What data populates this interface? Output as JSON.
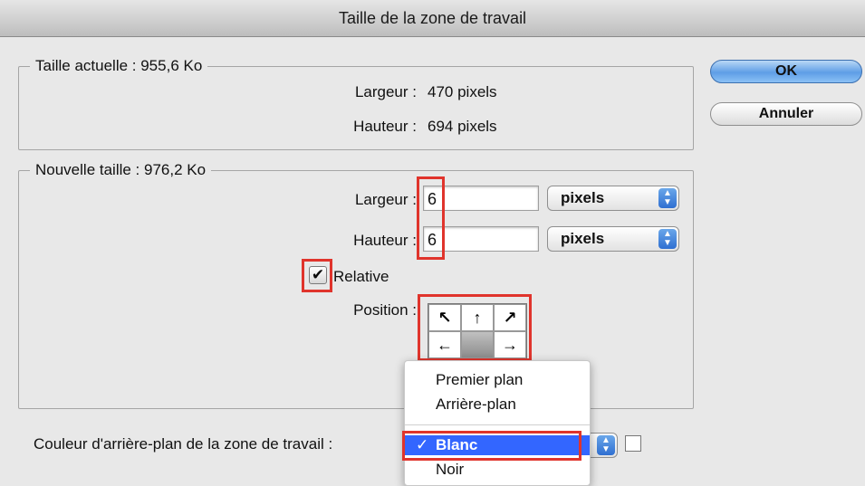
{
  "window": {
    "title": "Taille de la zone de travail"
  },
  "current_size": {
    "legend": "Taille actuelle : 955,6 Ko",
    "width_label": "Largeur :",
    "width_value": "470 pixels",
    "height_label": "Hauteur :",
    "height_value": "694 pixels"
  },
  "new_size": {
    "legend": "Nouvelle taille : 976,2 Ko",
    "width_label": "Largeur :",
    "width_value": "6",
    "width_unit": "pixels",
    "height_label": "Hauteur :",
    "height_value": "6",
    "height_unit": "pixels",
    "relative_label": "Relative",
    "relative_checked": true,
    "position_label": "Position :",
    "anchor": {
      "top_left": "↖",
      "top": "↑",
      "top_right": "↗",
      "left": "←",
      "center": "",
      "right": "→"
    }
  },
  "buttons": {
    "ok": "OK",
    "cancel": "Annuler"
  },
  "background": {
    "label": "Couleur d'arrière-plan de la zone de travail :",
    "selected": "Blanc",
    "swatch_color": "#ffffff",
    "menu": {
      "items": [
        "Premier plan",
        "Arrière-plan",
        "Blanc",
        "Noir"
      ],
      "check": "✓"
    }
  },
  "highlight_color": "#e0342c"
}
